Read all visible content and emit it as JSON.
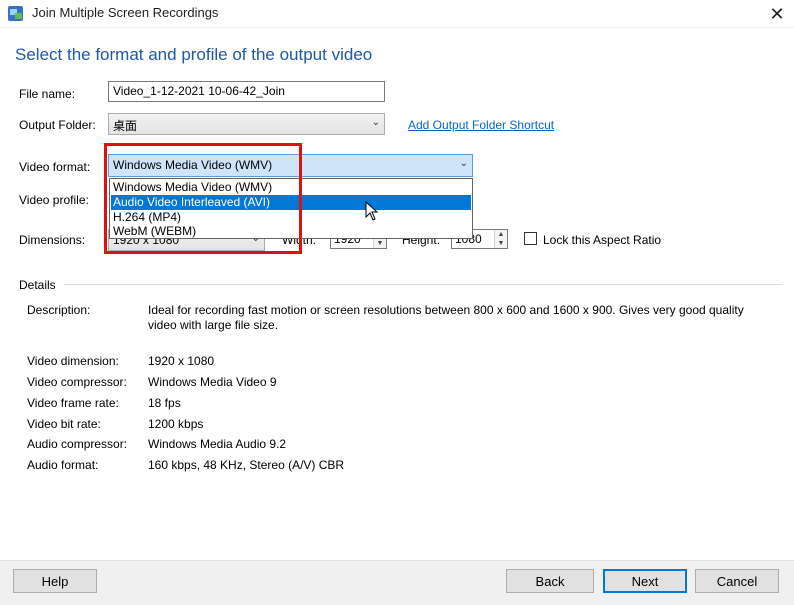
{
  "window": {
    "title": "Join Multiple Screen Recordings",
    "close_glyph": "✕"
  },
  "header": "Select the format and profile of the output video",
  "form": {
    "file_name_label": "File name:",
    "file_name_value": "Video_1-12-2021 10-06-42_Join",
    "output_folder_label": "Output Folder:",
    "output_folder_value": "桌面",
    "output_folder_link": "Add Output Folder Shortcut",
    "video_format_label": "Video format:",
    "video_format_value": "Windows Media Video (WMV)",
    "video_format_options": [
      "Windows Media Video (WMV)",
      "Audio Video Interleaved (AVI)",
      "H.264 (MP4)",
      "WebM (WEBM)"
    ],
    "video_format_highlighted_index": 1,
    "video_profile_label": "Video profile:",
    "dimensions_label": "Dimensions:",
    "dimensions_value": "1920 x 1080",
    "width_label": "Width:",
    "width_value": "1920",
    "height_label": "Height:",
    "height_value": "1080",
    "aspect_label": "Lock this Aspect Ratio",
    "aspect_checked": false
  },
  "details": {
    "section_label": "Details",
    "description_label": "Description:",
    "description_line1": "Ideal for recording fast motion or screen resolutions between 800 x 600 and 1600 x 900.  Gives very good quality",
    "description_line2": "video with large file size.",
    "rows": [
      {
        "label": "Video dimension:",
        "value": "1920 x 1080"
      },
      {
        "label": "Video compressor:",
        "value": "Windows Media Video 9"
      },
      {
        "label": "Video frame rate:",
        "value": "18 fps"
      },
      {
        "label": "Video bit rate:",
        "value": "1200 kbps"
      },
      {
        "label": "Audio compressor:",
        "value": "Windows Media Audio 9.2"
      },
      {
        "label": "Audio format:",
        "value": "160 kbps, 48 KHz, Stereo (A/V) CBR"
      }
    ]
  },
  "footer": {
    "help": "Help",
    "back": "Back",
    "next": "Next",
    "cancel": "Cancel"
  },
  "icons": {
    "app": "app-icon",
    "dropdown_arrow": "chevron-down-icon",
    "cursor": "mouse-pointer-icon"
  },
  "colors": {
    "header": "#1f58a8",
    "link": "#0a64c8",
    "selection": "#0078d7",
    "highlight_box": "#dd1111"
  }
}
